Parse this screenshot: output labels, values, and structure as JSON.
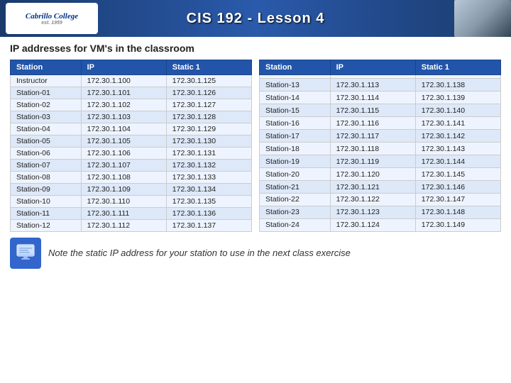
{
  "header": {
    "title": "CIS 192 - Lesson 4",
    "logo_text": "Cabrillo College",
    "logo_sub": "est. 1959"
  },
  "page": {
    "subtitle": "IP addresses for VM's in the classroom"
  },
  "table_left": {
    "headers": [
      "Station",
      "IP",
      "Static 1"
    ],
    "rows": [
      [
        "Instructor",
        "172.30.1.100",
        "172.30.1.125"
      ],
      [
        "Station-01",
        "172.30.1.101",
        "172.30.1.126"
      ],
      [
        "Station-02",
        "172.30.1.102",
        "172.30.1.127"
      ],
      [
        "Station-03",
        "172.30.1.103",
        "172.30.1.128"
      ],
      [
        "Station-04",
        "172.30.1.104",
        "172.30.1.129"
      ],
      [
        "Station-05",
        "172.30.1.105",
        "172.30.1.130"
      ],
      [
        "Station-06",
        "172.30.1.106",
        "172.30.1.131"
      ],
      [
        "Station-07",
        "172.30.1.107",
        "172.30.1.132"
      ],
      [
        "Station-08",
        "172.30.1.108",
        "172.30.1.133"
      ],
      [
        "Station-09",
        "172.30.1.109",
        "172.30.1.134"
      ],
      [
        "Station-10",
        "172.30.1.110",
        "172.30.1.135"
      ],
      [
        "Station-11",
        "172.30.1.111",
        "172.30.1.136"
      ],
      [
        "Station-12",
        "172.30.1.112",
        "172.30.1.137"
      ]
    ]
  },
  "table_right": {
    "headers": [
      "Station",
      "IP",
      "Static 1"
    ],
    "rows": [
      [
        "",
        "",
        ""
      ],
      [
        "Station-13",
        "172.30.1.113",
        "172.30.1.138"
      ],
      [
        "Station-14",
        "172.30.1.114",
        "172.30.1.139"
      ],
      [
        "Station-15",
        "172.30.1.115",
        "172.30.1.140"
      ],
      [
        "Station-16",
        "172.30.1.116",
        "172.30.1.141"
      ],
      [
        "Station-17",
        "172.30.1.117",
        "172.30.1.142"
      ],
      [
        "Station-18",
        "172.30.1.118",
        "172.30.1.143"
      ],
      [
        "Station-19",
        "172.30.1.119",
        "172.30.1.144"
      ],
      [
        "Station-20",
        "172.30.1.120",
        "172.30.1.145"
      ],
      [
        "Station-21",
        "172.30.1.121",
        "172.30.1.146"
      ],
      [
        "Station-22",
        "172.30.1.122",
        "172.30.1.147"
      ],
      [
        "Station-23",
        "172.30.1.123",
        "172.30.1.148"
      ],
      [
        "Station-24",
        "172.30.1.124",
        "172.30.1.149"
      ]
    ]
  },
  "footer": {
    "note": "Note the static IP address for your station to use in the next class exercise",
    "icon_label": "station-icon"
  }
}
